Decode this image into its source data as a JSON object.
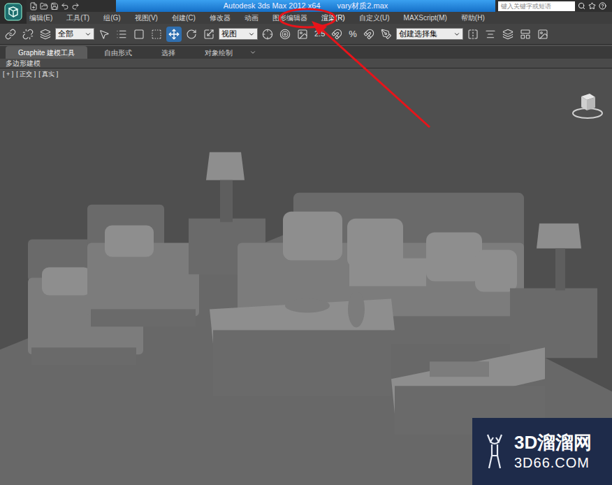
{
  "window": {
    "title": "Autodesk 3ds Max  2012 x64",
    "file": "vary材质2.max"
  },
  "search": {
    "placeholder": "键入关键字或短语"
  },
  "menu": [
    {
      "label": "编辑(E)",
      "highlighted": false
    },
    {
      "label": "工具(T)",
      "highlighted": false
    },
    {
      "label": "组(G)",
      "highlighted": false
    },
    {
      "label": "视图(V)",
      "highlighted": false
    },
    {
      "label": "创建(C)",
      "highlighted": false
    },
    {
      "label": "修改器",
      "highlighted": false
    },
    {
      "label": "动画",
      "highlighted": false
    },
    {
      "label": "图形编辑器",
      "highlighted": false
    },
    {
      "label": "渲染(R)",
      "highlighted": true
    },
    {
      "label": "自定义(U)",
      "highlighted": false
    },
    {
      "label": "MAXScript(M)",
      "highlighted": false
    },
    {
      "label": "帮助(H)",
      "highlighted": false
    }
  ],
  "toolbar": {
    "selection_filter": "全部",
    "reference_coord": "视图",
    "snap": "2.5",
    "percent_snap": "%",
    "named_selection": "创建选择集"
  },
  "ribbon": {
    "tabs": [
      {
        "label": "Graphite 建模工具",
        "selected": true
      },
      {
        "label": "自由形式",
        "selected": false
      },
      {
        "label": "选择",
        "selected": false
      },
      {
        "label": "对象绘制",
        "selected": false
      }
    ],
    "panel": "多边形建模"
  },
  "viewport": {
    "labels": [
      "+",
      "正交",
      "真实"
    ]
  },
  "watermark": {
    "name": "3D溜溜网",
    "url": "3D66.COM"
  }
}
